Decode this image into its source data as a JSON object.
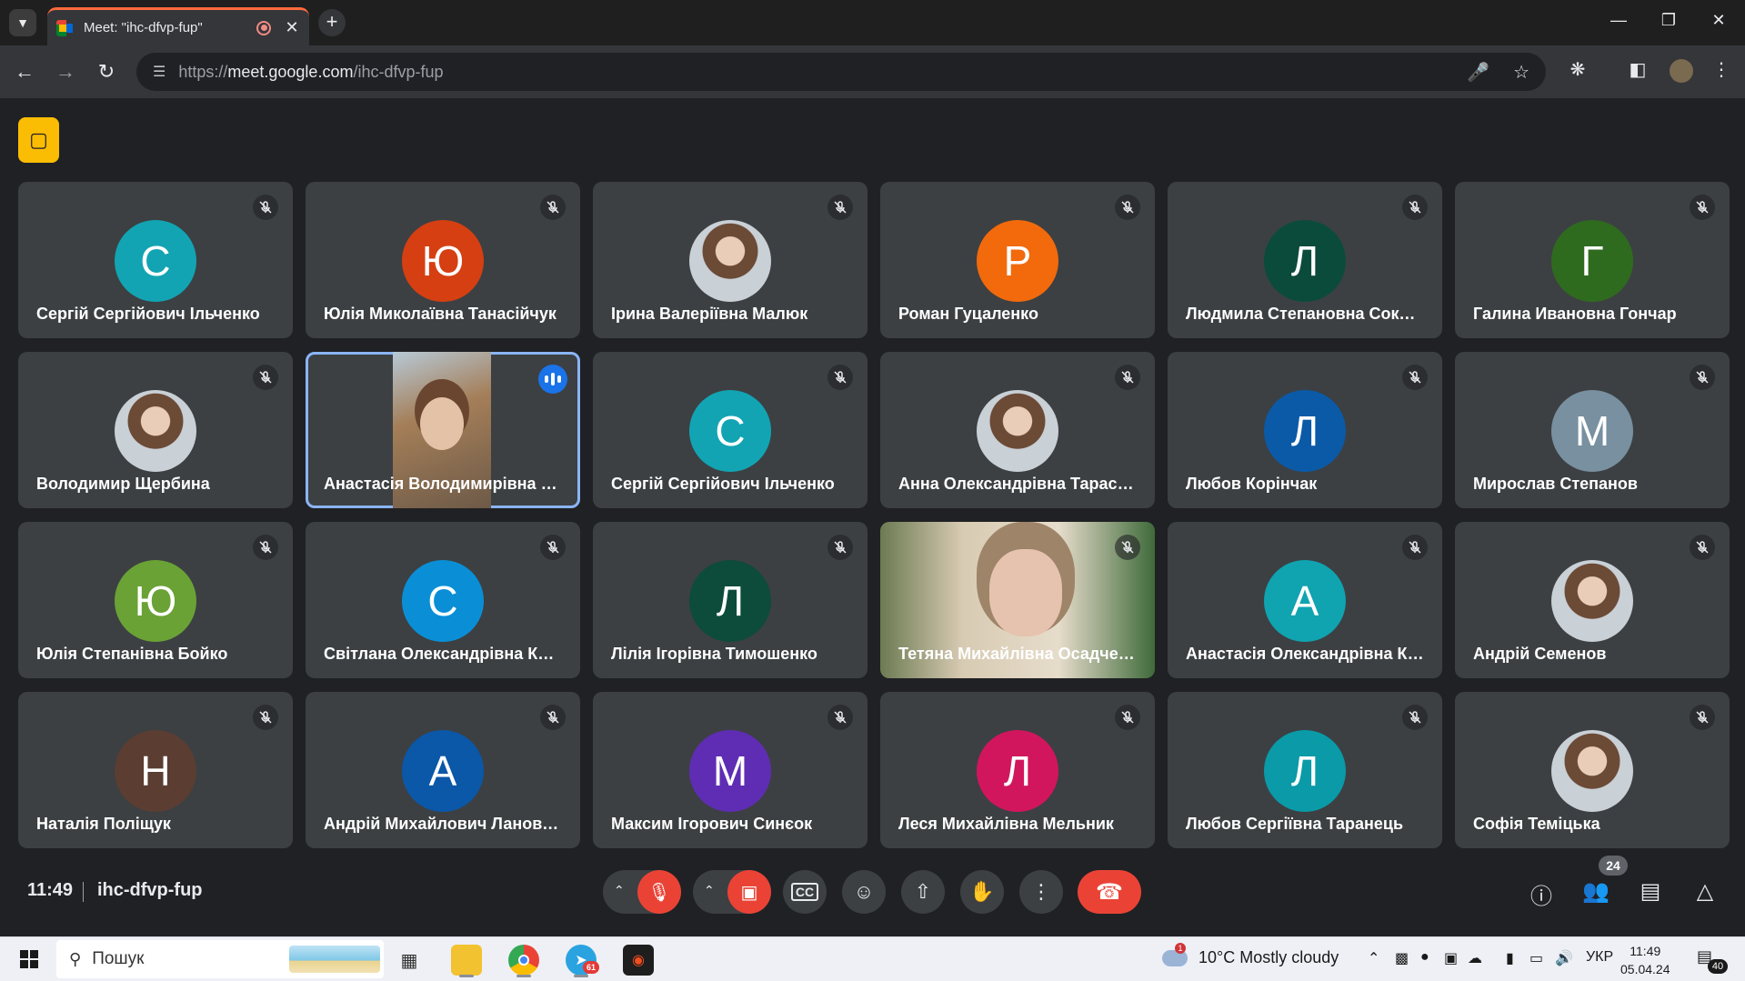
{
  "browser": {
    "tab_title": "Meet: \"ihc-dfvp-fup\"",
    "url_prefix": "https://",
    "url_host": "meet.google.com",
    "url_path": "/ihc-dfvp-fup"
  },
  "colors": {
    "accent": "#8ab4f8",
    "danger": "#ea4335",
    "tile_bg": "#3c4043",
    "page_bg": "#202124"
  },
  "participants": [
    {
      "name": "Сергій Сергійович Ільченко",
      "initial": "С",
      "color": "#12a4b3"
    },
    {
      "name": "Юлія Миколаївна Танасійчук",
      "initial": "Ю",
      "color": "#d53f12"
    },
    {
      "name": "Ірина Валеріївна Малюк",
      "initial": "",
      "color": "",
      "photo": true
    },
    {
      "name": "Роман Гуцаленко",
      "initial": "Р",
      "color": "#f26a0c"
    },
    {
      "name": "Людмила Степановна Сокол...",
      "initial": "Л",
      "color": "#0b4b3c"
    },
    {
      "name": "Галина Ивановна Гончар",
      "initial": "Г",
      "color": "#2f6b1e"
    },
    {
      "name": "Володимир Щербина",
      "initial": "",
      "color": "",
      "photo": true
    },
    {
      "name": "Анастасія Володимирівна За...",
      "initial": "",
      "color": "",
      "video": "anastasia",
      "speaking": true
    },
    {
      "name": "Сергій Сергійович Ільченко",
      "initial": "С",
      "color": "#12a4b3"
    },
    {
      "name": "Анна Олександрівна Тарасюк",
      "initial": "",
      "color": "",
      "photo": true
    },
    {
      "name": "Любов Корінчак",
      "initial": "Л",
      "color": "#0b5aa8"
    },
    {
      "name": "Мирослав Степанов",
      "initial": "М",
      "color": "#7890a0"
    },
    {
      "name": "Юлія Степанівна Бойко",
      "initial": "Ю",
      "color": "#6aa235"
    },
    {
      "name": "Світлана Олександрівна Коз...",
      "initial": "С",
      "color": "#0a8fd6"
    },
    {
      "name": "Лілія Ігорівна Тимошенко",
      "initial": "Л",
      "color": "#0d4b3b"
    },
    {
      "name": "Тетяна Михайлівна Осадчен...",
      "initial": "",
      "color": "",
      "video": "tetyana"
    },
    {
      "name": "Анастасія Олександрівна Ка...",
      "initial": "А",
      "color": "#10a3b0"
    },
    {
      "name": "Андрій Семенов",
      "initial": "",
      "color": "",
      "photo": true
    },
    {
      "name": "Наталія Поліщук",
      "initial": "Н",
      "color": "#5b3d32"
    },
    {
      "name": "Андрій Михайлович Ланове...",
      "initial": "А",
      "color": "#0b57a8"
    },
    {
      "name": "Максим Ігорович Синєок",
      "initial": "М",
      "color": "#5f2db3"
    },
    {
      "name": "Леся Михайлівна Мельник",
      "initial": "Л",
      "color": "#d1165e"
    },
    {
      "name": "Любов Сергіївна Таранець",
      "initial": "Л",
      "color": "#0a9aa8"
    },
    {
      "name": "Софія Теміцька",
      "initial": "",
      "color": "",
      "photo": true
    }
  ],
  "meeting": {
    "time": "11:49",
    "code": "ihc-dfvp-fup",
    "people_count": "24"
  },
  "taskbar": {
    "search_label": "Пошук",
    "telegram_badge": "61",
    "weather_alert": "1",
    "weather": "10°C  Mostly cloudy",
    "language": "УКР",
    "clock_time": "11:49",
    "clock_date": "05.04.24",
    "notifications": "40"
  }
}
